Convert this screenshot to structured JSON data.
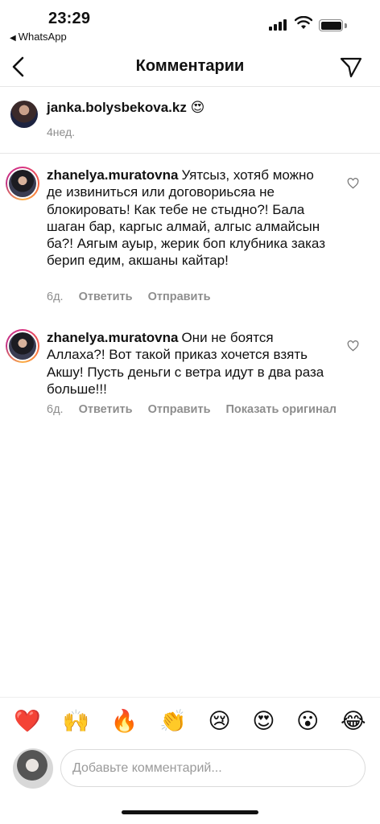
{
  "status_bar": {
    "time": "23:29",
    "back_app": "WhatsApp"
  },
  "header": {
    "title": "Комментарии"
  },
  "caption": {
    "username": "janka.bolysbekova.kz",
    "emoji": "😍",
    "time": "4нед."
  },
  "comments": [
    {
      "username": "zhanelya.muratovna",
      "text": "Уятсыз, хотяб можно де извиниться или договориьсяа не блокировать! Как тебе не стыдно?! Бала шаган бар, каргыс алмай, алгыс алмайсын ба?! Аягым ауыр, жерик боп клубника заказ берип едим, акшаны кайтар!",
      "time": "6д.",
      "reply": "Ответить",
      "send": "Отправить"
    },
    {
      "username": "zhanelya.muratovna",
      "text": "Они не боятся Аллаха?! Вот такой приказ хочется взять Акшу! Пусть деньги с ветра идут в два раза больше!!!",
      "time": "6д.",
      "reply": "Ответить",
      "send": "Отправить",
      "show_original": "Показать оригинал"
    }
  ],
  "reactions": [
    "❤️",
    "🙌",
    "🔥",
    "👏",
    "😢",
    "😍",
    "😮",
    "😂"
  ],
  "composer": {
    "placeholder": "Добавьте комментарий..."
  }
}
